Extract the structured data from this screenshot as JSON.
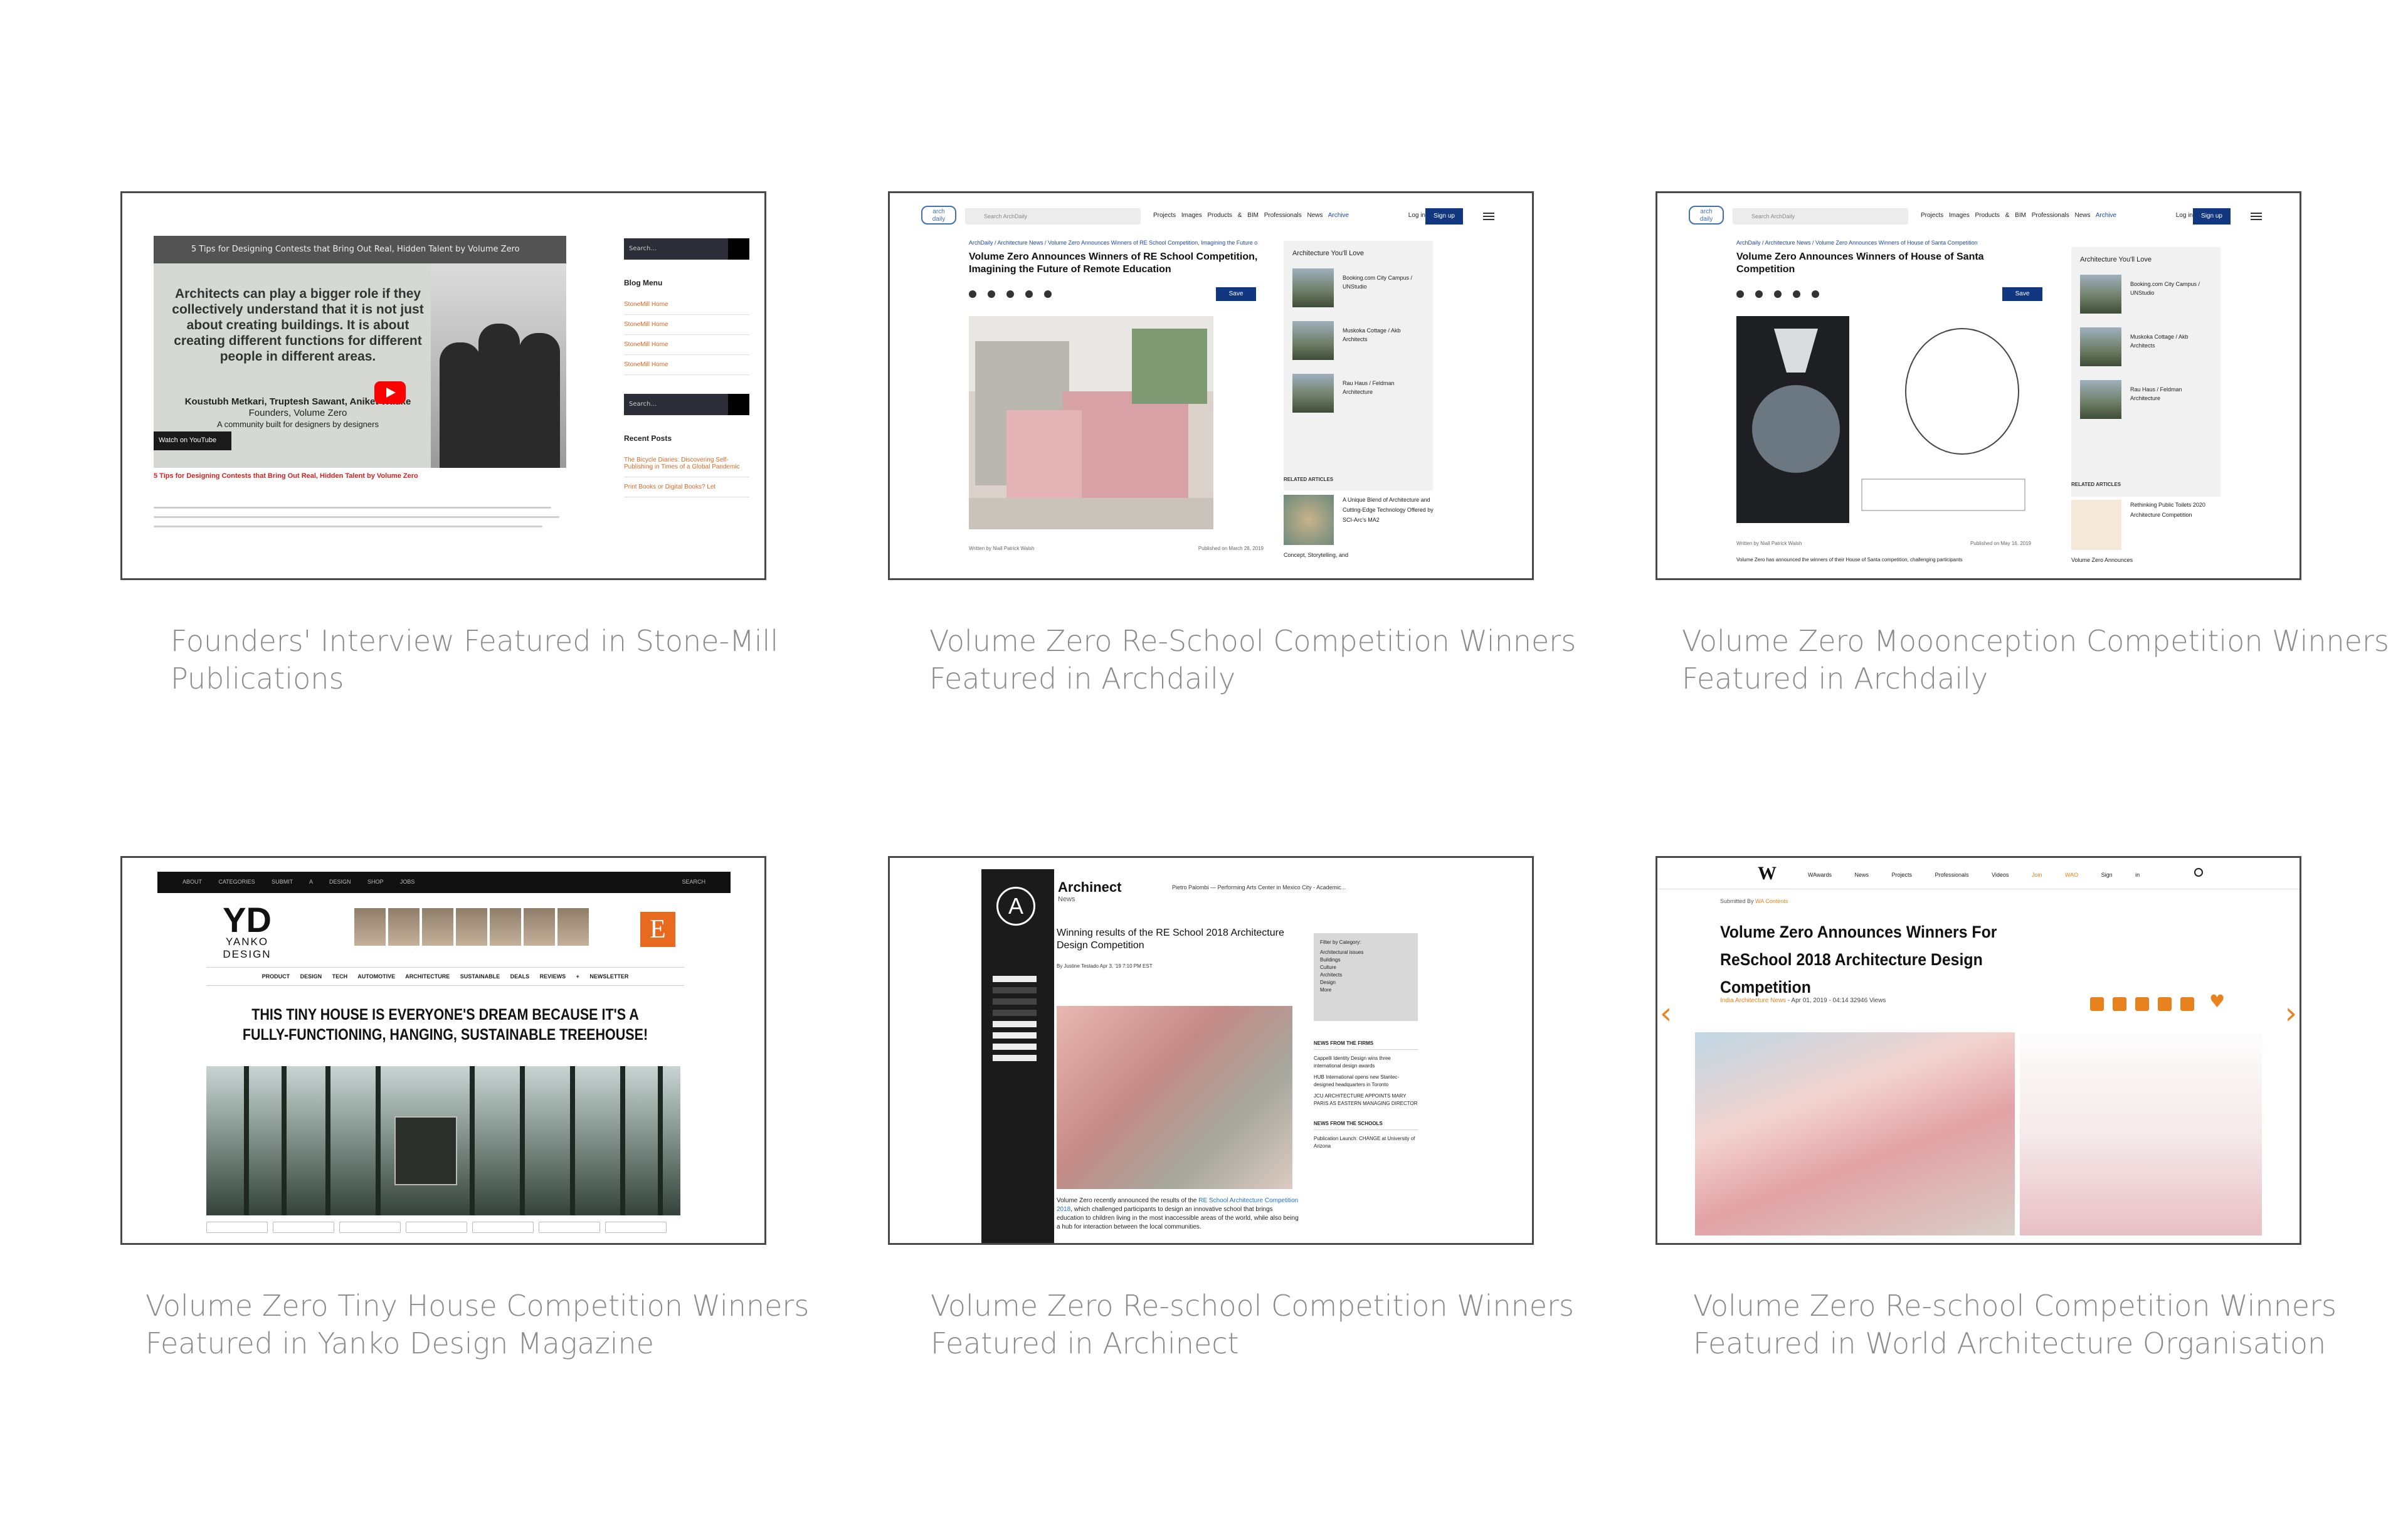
{
  "cards": [
    {
      "caption_line1": "Founders' Interview Featured in Stone-Mill",
      "caption_line2": "Publications"
    },
    {
      "caption_line1": "Volume Zero Re-School Competition Winners",
      "caption_line2": "Featured in Archdaily"
    },
    {
      "caption_line1": "Volume Zero Mooonception Competition Winners",
      "caption_line2": "Featured in Archdaily"
    },
    {
      "caption_line1": "Volume Zero Tiny House Competition Winners",
      "caption_line2": "Featured in Yanko Design Magazine"
    },
    {
      "caption_line1": "Volume Zero Re-school Competition Winners",
      "caption_line2": "Featured in Archinect"
    },
    {
      "caption_line1": "Volume Zero Re-school Competition Winners",
      "caption_line2": "Featured in World Architecture Organisation"
    }
  ],
  "stonemill": {
    "video_title": "5 Tips for Designing Contests that Bring Out Real, Hidden Talent by Volume Zero",
    "quote": "Architects can play a bigger role if they collectively understand that it is not just about creating buildings. It is about creating different functions for different people in different areas.",
    "names": "Koustubh Metkari, Truptesh Sawant, Aniket Wadke",
    "role": "Founders, Volume Zero",
    "tagline": "A community built for designers by designers",
    "watch_on": "Watch on YouTube",
    "link": "5 Tips for Designing Contests that Bring Out Real, Hidden Talent by Volume Zero",
    "search_placeholder": "Search...",
    "blog_menu": "Blog Menu",
    "menu_items": [
      "StoneMill Home",
      "StoneMill Home",
      "StoneMill Home",
      "StoneMill Home"
    ],
    "recent_posts": "Recent Posts",
    "recent_items": [
      "The Bicycle Diaries: Discovering Self-Publishing in Times of a Global Pandemic",
      "Print Books or Digital Books? Let"
    ]
  },
  "archdaily1": {
    "search_placeholder": "Search ArchDaily",
    "nav": "Projects Images Products & BIM Professionals News",
    "nav_archive": "Archive",
    "login": "Log in",
    "signup": "Sign up",
    "crumb": "ArchDaily  /  Architecture News  /  Volume Zero Announces Winners of RE School Competition, Imagining the Future o",
    "title": "Volume Zero Announces Winners of RE School Competition, Imagining the Future of Remote Education",
    "save": "Save",
    "byline_left": "Written by Niall Patrick Walsh",
    "byline_right": "Published on March 28, 2019",
    "side_title": "Architecture You'll Love",
    "side_items": [
      "Booking.com City Campus / UNStudio",
      "Muskoka Cottage / Akb Architects",
      "Rau Haus / Feldman Architecture"
    ],
    "related_title": "RELATED ARTICLES",
    "related_item": "A Unique Blend of Architecture and Cutting-Edge Technology Offered by SCI-Arc's MA2",
    "related_item2": "Concept, Storytelling, and"
  },
  "archdaily2": {
    "crumb": "ArchDaily  /  Architecture News  /  Volume Zero Announces Winners of House of Santa Competition",
    "title": "Volume Zero Announces Winners of House of Santa Competition",
    "byline_left": "Written by Niall Patrick Walsh",
    "byline_right": "Published on May 16, 2019",
    "intro": "Volume Zero has announced the winners of their House of Santa competition, challenging participants",
    "related_item": "Rethinking Public Toilets 2020 Architecture Competition",
    "related_item2": "Volume Zero Announces"
  },
  "yanko": {
    "topnav": "ABOUT CATEGORIES SUBMIT A DESIGN SHOP JOBS",
    "search": "SEARCH",
    "logo": "YD",
    "logo_sub": "YANKO DESIGN",
    "ad_letter": "E",
    "nav": "PRODUCT DESIGN TECH AUTOMOTIVE ARCHITECTURE SUSTAINABLE DEALS REVIEWS + NEWSLETTER",
    "headline": "THIS TINY HOUSE IS EVERYONE'S DREAM BECAUSE IT'S A FULLY-FUNCTIONING, HANGING, SUSTAINABLE TREEHOUSE!"
  },
  "archinect": {
    "logo_letter": "A",
    "brand": "Archinect",
    "brand_sub": "News",
    "crumb": "Pietro Palombi — Performing Arts Center in Mexico City - Academic...",
    "title": "Winning results of the RE School 2018 Architecture Design Competition",
    "meta": "By Justine Testado   Apr 3, '19 7:10 PM EST",
    "body": "Volume Zero recently announced the results of the",
    "body_link": "RE School Architecture Competition 2018",
    "body_rest": ", which challenged participants to design an innovative school that brings education to children living in the most inaccessible areas of the world, while also being a hub for interaction between the local communities.",
    "filter_title": "Filter by Category:",
    "filter_items": [
      "Architectural issues",
      "Buildings",
      "Culture",
      "Architects",
      "Design",
      "More"
    ],
    "firms_title": "NEWS FROM THE FIRMS",
    "firms_items": [
      "Cappelli Identity Design wins three international design awards",
      "HUB International opens new Stantec-designed headquarters in Toronto",
      "JCU ARCHITECTURE APPOINTS MARY PARIS AS EASTERN MANAGING DIRECTOR"
    ],
    "schools_title": "NEWS FROM THE SCHOOLS",
    "schools_item": "Publication Launch: CHANGE at University of Arizona"
  },
  "wao": {
    "logo": "W",
    "nav": "WAwards News Projects Professionals Videos",
    "nav_highlight": "Join WAO",
    "nav_signin": "Sign in",
    "submitted": "Submitted By",
    "submitted_by": "WA Contents",
    "title": "Volume Zero Announces Winners For ReSchool 2018 Architecture Design Competition",
    "category": "India Architecture News",
    "date_views": "- Apr 01, 2019 - 04:14   32946 Views"
  }
}
